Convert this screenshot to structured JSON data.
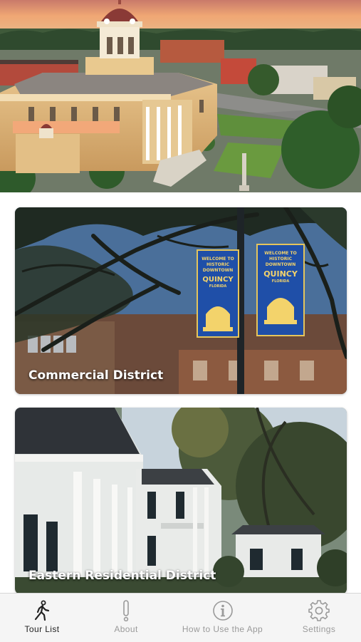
{
  "colors": {
    "tab_active": "#222222",
    "tab_inactive": "#9a9a9a",
    "tabbar_background": "#f5f5f5",
    "card_title": "#ffffff"
  },
  "hero": {
    "image": "Quincy courthouse aerial view at sunset"
  },
  "tours": [
    {
      "title": "Commercial District",
      "image": "oak tree with Welcome to Historic Downtown Quincy banners"
    },
    {
      "title": "Eastern Residential District",
      "image": "historic white two-story houses with columned porches"
    }
  ],
  "banner": {
    "line1": "WELCOME TO",
    "line2": "HISTORIC",
    "line3": "DOWNTOWN",
    "line4": "QUINCY",
    "line5": "FLORIDA"
  },
  "tabbar": {
    "tabs": [
      {
        "label": "Tour List",
        "icon": "walking-person-icon",
        "active": true
      },
      {
        "label": "About",
        "icon": "exclamation-icon",
        "active": false
      },
      {
        "label": "How to Use the App",
        "icon": "info-circle-icon",
        "active": false
      },
      {
        "label": "Settings",
        "icon": "gear-icon",
        "active": false
      }
    ]
  }
}
